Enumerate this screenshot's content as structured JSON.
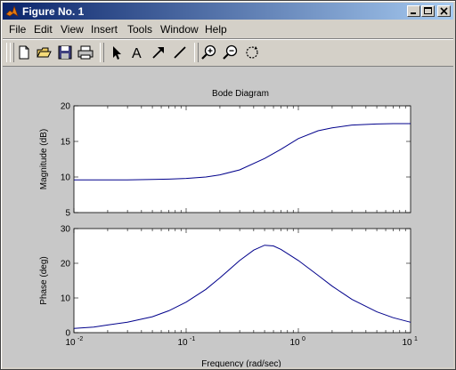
{
  "window": {
    "title": "Figure No. 1",
    "minimize_icon": "minimize-icon",
    "maximize_icon": "maximize-icon",
    "close_icon": "close-icon"
  },
  "menu": [
    {
      "label": "File"
    },
    {
      "label": "Edit"
    },
    {
      "label": "View"
    },
    {
      "label": "Insert"
    },
    {
      "label": "Tools"
    },
    {
      "label": "Window"
    },
    {
      "label": "Help"
    }
  ],
  "toolbar": [
    {
      "icon": "new-figure-icon"
    },
    {
      "icon": "open-file-icon"
    },
    {
      "icon": "save-icon"
    },
    {
      "icon": "print-icon"
    },
    {
      "icon": "edit-plot-arrow-icon"
    },
    {
      "icon": "insert-text-icon",
      "glyph": "A"
    },
    {
      "icon": "insert-arrow-icon"
    },
    {
      "icon": "insert-line-icon"
    },
    {
      "icon": "zoom-in-icon"
    },
    {
      "icon": "zoom-out-icon"
    },
    {
      "icon": "rotate-3d-icon"
    }
  ],
  "chart_data": {
    "type": "line",
    "title": "Bode Diagram",
    "xlabel": "Frequency (rad/sec)",
    "x_scale": "log",
    "xlim": [
      0.01,
      10
    ],
    "x_ticks": [
      "10",
      "10",
      "10",
      "10"
    ],
    "x_tick_exponents": [
      "-2",
      "-1",
      "0",
      "1"
    ],
    "line_color": "#00008b",
    "panels": [
      {
        "name": "magnitude",
        "ylabel": "Magnitude (dB)",
        "ylim": [
          5,
          20
        ],
        "y_ticks": [
          "5",
          "10",
          "15",
          "20"
        ],
        "x": [
          0.01,
          0.02,
          0.03,
          0.05,
          0.07,
          0.1,
          0.15,
          0.2,
          0.3,
          0.5,
          0.7,
          1,
          1.5,
          2,
          3,
          5,
          7,
          10
        ],
        "y": [
          9.6,
          9.6,
          9.6,
          9.65,
          9.7,
          9.8,
          10.0,
          10.3,
          11.0,
          12.6,
          13.9,
          15.4,
          16.5,
          16.9,
          17.3,
          17.45,
          17.5,
          17.5
        ]
      },
      {
        "name": "phase",
        "ylabel": "Phase (deg)",
        "ylim": [
          0,
          30
        ],
        "y_ticks": [
          "0",
          "10",
          "20",
          "30"
        ],
        "x": [
          0.01,
          0.015,
          0.02,
          0.03,
          0.05,
          0.07,
          0.1,
          0.15,
          0.2,
          0.3,
          0.4,
          0.5,
          0.6,
          0.7,
          1,
          1.5,
          2,
          3,
          5,
          7,
          10
        ],
        "y": [
          1.2,
          1.6,
          2.2,
          3.0,
          4.6,
          6.3,
          8.8,
          12.5,
          15.8,
          20.8,
          23.8,
          25.2,
          25.0,
          24.0,
          20.8,
          16.5,
          13.4,
          9.6,
          6.0,
          4.3,
          3.0
        ]
      }
    ]
  }
}
